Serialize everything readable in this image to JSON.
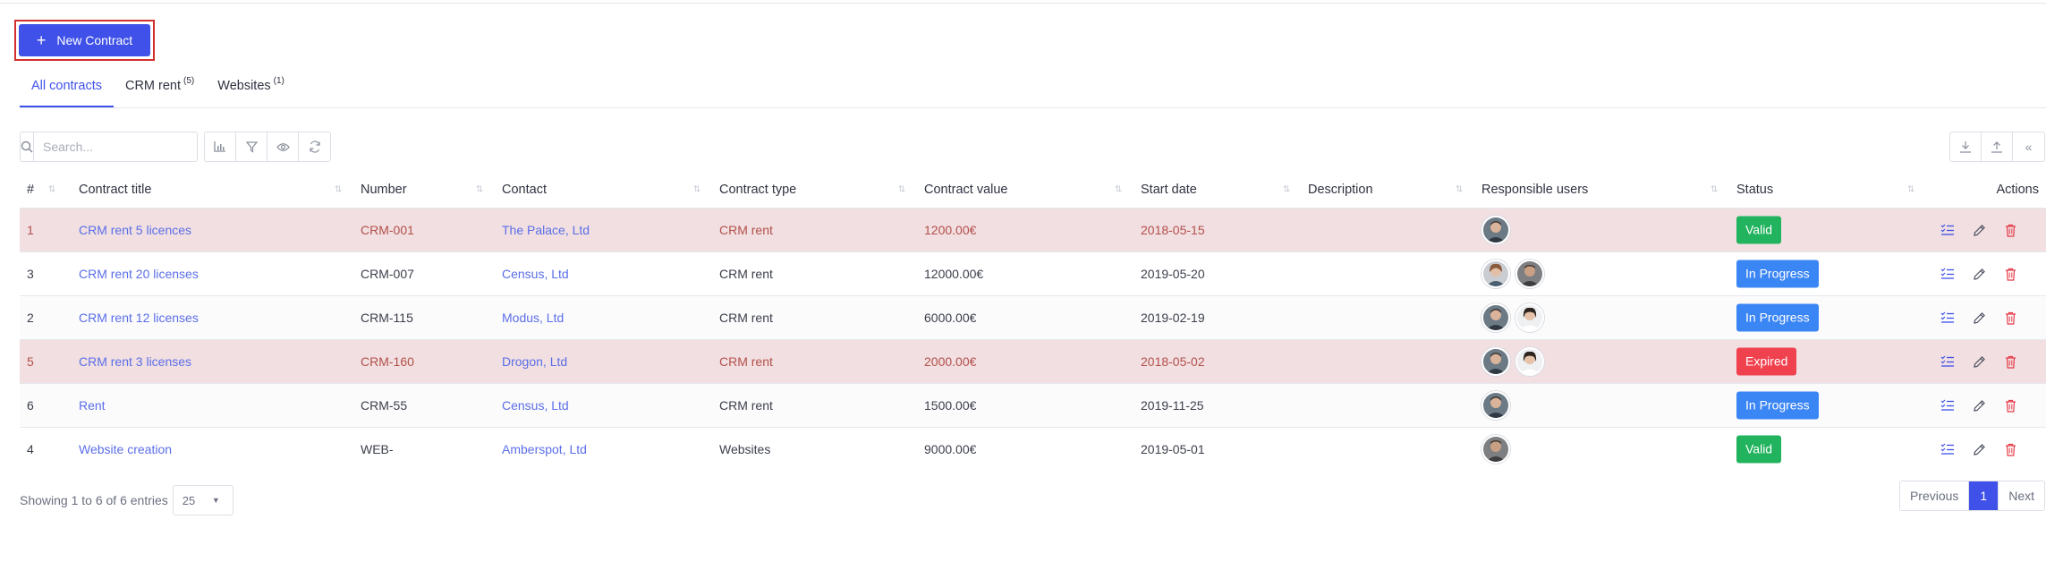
{
  "new_contract_label": "New Contract",
  "tabs": [
    {
      "label": "All contracts",
      "count": "",
      "active": true
    },
    {
      "label": "CRM rent",
      "count": "(5)",
      "active": false
    },
    {
      "label": "Websites",
      "count": "(1)",
      "active": false
    }
  ],
  "search": {
    "placeholder": "Search..."
  },
  "toolbar": {
    "icons": [
      "chart-icon",
      "filter-icon",
      "eye-icon",
      "refresh-icon"
    ],
    "right_icons": [
      "download-icon",
      "upload-icon",
      "collapse-icon"
    ],
    "collapse_glyph": "«"
  },
  "table": {
    "headers": {
      "num": "#",
      "title": "Contract title",
      "number": "Number",
      "contact": "Contact",
      "type": "Contract type",
      "value": "Contract value",
      "start": "Start date",
      "desc": "Description",
      "users": "Responsible users",
      "status": "Status",
      "actions": "Actions"
    },
    "rows": [
      {
        "num": "1",
        "title": "CRM rent 5 licences",
        "number": "CRM-001",
        "contact": "The Palace, Ltd",
        "type": "CRM rent",
        "value": "1200.00€",
        "start": "2018-05-15",
        "desc": "",
        "users": 1,
        "status": "Valid",
        "tone": "danger"
      },
      {
        "num": "3",
        "title": "CRM rent 20 licenses",
        "number": "CRM-007",
        "contact": "Census, Ltd",
        "type": "CRM rent",
        "value": "12000.00€",
        "start": "2019-05-20",
        "desc": "",
        "users": 2,
        "status": "In Progress",
        "tone": "plain"
      },
      {
        "num": "2",
        "title": "CRM rent 12 licenses",
        "number": "CRM-115",
        "contact": "Modus, Ltd",
        "type": "CRM rent",
        "value": "6000.00€",
        "start": "2019-02-19",
        "desc": "",
        "users": 2,
        "status": "In Progress",
        "tone": "striped"
      },
      {
        "num": "5",
        "title": "CRM rent 3 licenses",
        "number": "CRM-160",
        "contact": "Drogon, Ltd",
        "type": "CRM rent",
        "value": "2000.00€",
        "start": "2018-05-02",
        "desc": "",
        "users": 2,
        "status": "Expired",
        "tone": "danger"
      },
      {
        "num": "6",
        "title": "Rent",
        "number": "CRM-55",
        "contact": "Census, Ltd",
        "type": "CRM rent",
        "value": "1500.00€",
        "start": "2019-11-25",
        "desc": "",
        "users": 1,
        "status": "In Progress",
        "tone": "striped"
      },
      {
        "num": "4",
        "title": "Website creation",
        "number": "WEB-",
        "contact": "Amberspot, Ltd",
        "type": "Websites",
        "value": "9000.00€",
        "start": "2019-05-01",
        "desc": "",
        "users": 1,
        "status": "Valid",
        "tone": "plain"
      }
    ]
  },
  "footer": {
    "showing": "Showing 1 to 6 of 6 entries",
    "page_size": "25",
    "prev": "Previous",
    "page": "1",
    "next": "Next"
  },
  "colors": {
    "primary": "#3f51e8",
    "valid": "#22b35e",
    "progress": "#3b86f5",
    "expired": "#f0414f",
    "danger_row": "#f1dfe1"
  }
}
